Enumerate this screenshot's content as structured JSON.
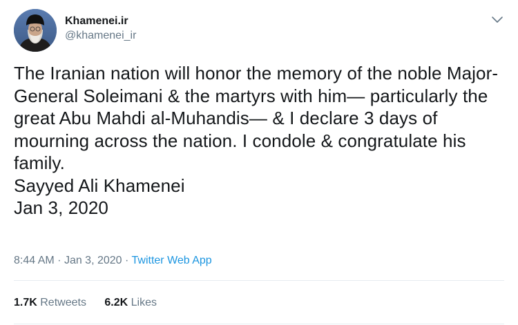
{
  "author": {
    "display_name": "Khamenei.ir",
    "handle": "@khamenei_ir"
  },
  "tweet": {
    "text": "The Iranian nation will honor the memory of the noble Major-General Soleimani & the martyrs with him— particularly the great Abu Mahdi al-Muhandis— & I declare 3 days of mourning across the nation. I condole & congratulate his family.\nSayyed Ali Khamenei\nJan 3, 2020",
    "time": "8:44 AM",
    "separator": "·",
    "date": "Jan 3, 2020",
    "source": "Twitter Web App"
  },
  "stats": {
    "retweets_count": "1.7K",
    "retweets_label": "Retweets",
    "likes_count": "6.2K",
    "likes_label": "Likes"
  },
  "colors": {
    "text": "#14171a",
    "secondary": "#657786",
    "link": "#1b95e0",
    "divider": "#e6ecf0"
  },
  "icons": {
    "menu": "chevron-down-icon",
    "avatar": "avatar"
  }
}
